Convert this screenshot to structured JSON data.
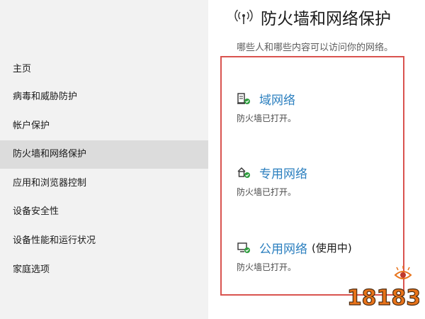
{
  "sidebar": {
    "items": [
      {
        "label": "主页"
      },
      {
        "label": "病毒和威胁防护"
      },
      {
        "label": "帐户保护"
      },
      {
        "label": "防火墙和网络保护"
      },
      {
        "label": "应用和浏览器控制"
      },
      {
        "label": "设备安全性"
      },
      {
        "label": "设备性能和运行状况"
      },
      {
        "label": "家庭选项"
      }
    ],
    "selected_index": 3
  },
  "main": {
    "title": "防火墙和网络保护",
    "title_icon": "antenna-icon",
    "subtitle": "哪些人和哪些内容可以访问你的网络。",
    "networks": [
      {
        "icon": "domain-network-icon",
        "label": "域网络",
        "active": "",
        "status": "防火墙已打开。"
      },
      {
        "icon": "private-network-icon",
        "label": "专用网络",
        "active": "",
        "status": "防火墙已打开。"
      },
      {
        "icon": "public-network-icon",
        "label": "公用网络",
        "active": "(使用中)",
        "status": "防火墙已打开。"
      }
    ]
  },
  "watermark": {
    "text": "18183"
  },
  "colors": {
    "link": "#2b7fbf",
    "highlight_border": "#d9534f",
    "sidebar_bg": "#f2f2f2",
    "selected_bg": "#dcdcdc",
    "status_ok": "#2e9e3e"
  }
}
